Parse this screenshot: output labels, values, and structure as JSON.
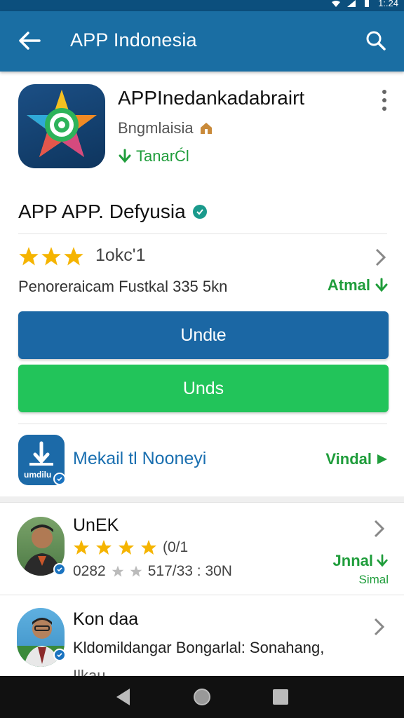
{
  "status_bar": {
    "time": "1:.24"
  },
  "app_bar": {
    "title": "APP Indonesia"
  },
  "app": {
    "name": "APPInedankadabrairt",
    "developer": "Bngmlaisia",
    "tag": "TanarĆl",
    "subtitle": "APP APP. Defyusia"
  },
  "rating": {
    "stars_filled": 3,
    "stars_total": 5,
    "text": "1okc'1"
  },
  "description": {
    "text": "Penoreraicam Fustkal 335 5kn",
    "action": "Atmal"
  },
  "buttons": {
    "primary": "Undɩe",
    "secondary": "Unds"
  },
  "feature": {
    "icon_text": "umdilu",
    "label": "Mekail tl Nooneyi",
    "action": "Vindal"
  },
  "reviews": [
    {
      "name": "UnEK",
      "stars_filled": 4,
      "stars_total": 5,
      "rating_text": "(0/1",
      "meta": "0282",
      "meta_detail": "517/33  : 30N",
      "action": "Jnnal",
      "sub": "Simal"
    },
    {
      "name": "Kon daa",
      "text": "Kldomildangar Bongarlal: Sonahang,",
      "text2": "Ilkau"
    }
  ],
  "colors": {
    "app_bar": "#1a6ea3",
    "status_bar": "#0c4f7d",
    "primary_button": "#1b67a4",
    "secondary_button": "#22c45a",
    "accent_green": "#1f9d3b",
    "star": "#f5b400"
  }
}
